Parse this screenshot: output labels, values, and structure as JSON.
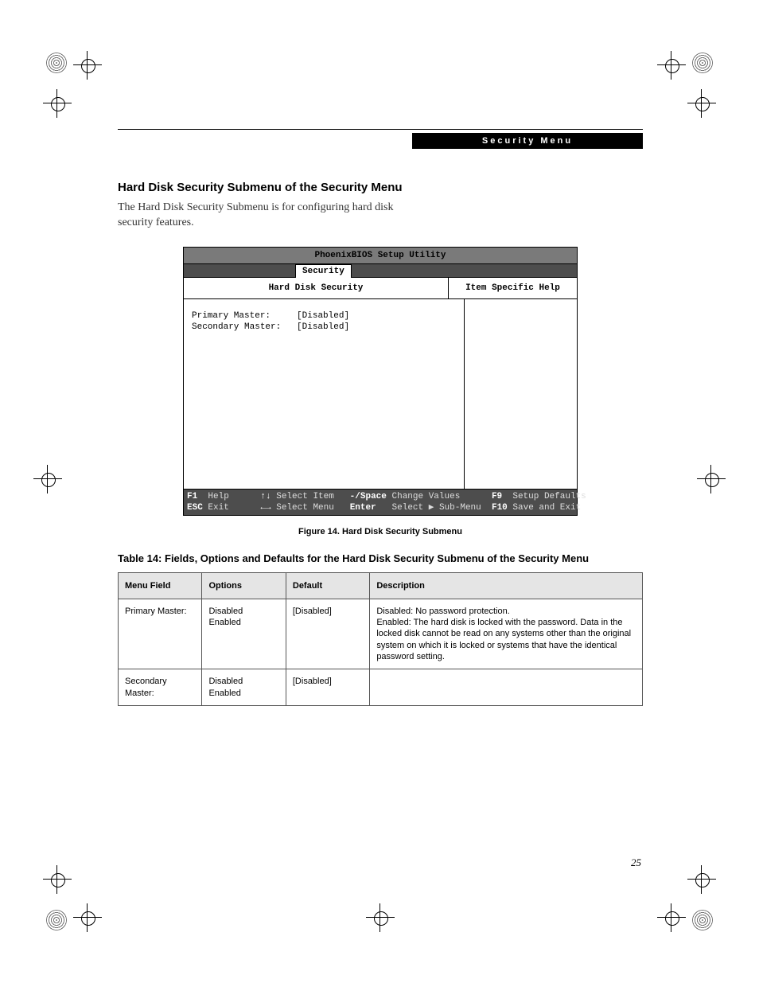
{
  "header": {
    "label": "Security Menu"
  },
  "section": {
    "title": "Hard Disk Security Submenu of the Security Menu",
    "intro": "The Hard Disk Security Submenu is for configuring hard disk security features."
  },
  "bios": {
    "title": "PhoenixBIOS Setup Utility",
    "tab": "Security",
    "panel_left_title": "Hard Disk Security",
    "panel_right_title": "Item Specific Help",
    "fields": {
      "primary_label": "Primary Master:",
      "primary_value": "[Disabled]",
      "secondary_label": "Secondary Master:",
      "secondary_value": "[Disabled]"
    },
    "footer": {
      "r1_k1": "F1",
      "r1_t1": "Help",
      "r1_k2": "↑↓",
      "r1_t2": "Select Item",
      "r1_k3": "-/Space",
      "r1_t3": "Change Values",
      "r1_k4": "F9",
      "r1_t4": "Setup Defaults",
      "r2_k1": "ESC",
      "r2_t1": "Exit",
      "r2_k2": "←→",
      "r2_t2": "Select Menu",
      "r2_k3": "Enter",
      "r2_t3": "Select ▶ Sub-Menu",
      "r2_k4": "F10",
      "r2_t4": "Save and Exit"
    }
  },
  "figure_caption": "Figure 14.  Hard Disk Security Submenu",
  "table_caption": "Table 14: Fields, Options and Defaults for the Hard Disk Security Submenu of the Security Menu",
  "table": {
    "headers": {
      "c1": "Menu Field",
      "c2": "Options",
      "c3": "Default",
      "c4": "Description"
    },
    "rows": [
      {
        "field": "Primary Master:",
        "options": "Disabled\nEnabled",
        "default": "[Disabled]",
        "description": "Disabled: No password protection.\nEnabled: The hard disk is locked with the password. Data in the locked disk cannot be read on any systems other than the original system on which it is locked or systems that have the identical password setting."
      },
      {
        "field": "Secondary Master:",
        "options": "Disabled\nEnabled",
        "default": "[Disabled]",
        "description": ""
      }
    ]
  },
  "page_number": "25"
}
